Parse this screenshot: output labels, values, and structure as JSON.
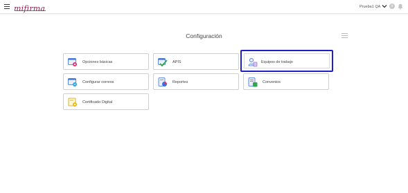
{
  "header": {
    "logo_text": "mifirma",
    "user_name": "Prueba1 QA",
    "info_symbol": "i"
  },
  "page": {
    "title": "Configuración"
  },
  "cards": [
    {
      "label": "Opciones básicas",
      "icon": "settings-window-icon"
    },
    {
      "label": "APIS",
      "icon": "api-check-icon"
    },
    {
      "label": "Equipos de trabajo",
      "icon": "team-icon",
      "selected": true
    },
    {
      "label": "Configurar correos",
      "icon": "mail-settings-icon"
    },
    {
      "label": "Reportes",
      "icon": "report-chart-icon"
    },
    {
      "label": "Convenios",
      "icon": "agreement-icon"
    },
    {
      "label": "Certificado Digital",
      "icon": "certificate-icon"
    }
  ],
  "colors": {
    "brand": "#8a1f4f",
    "selection": "#1f1fc4",
    "icon_blue": "#3b6fd8",
    "icon_pink": "#e0337a",
    "icon_green": "#2fa84f",
    "icon_yellow": "#f2b705"
  }
}
